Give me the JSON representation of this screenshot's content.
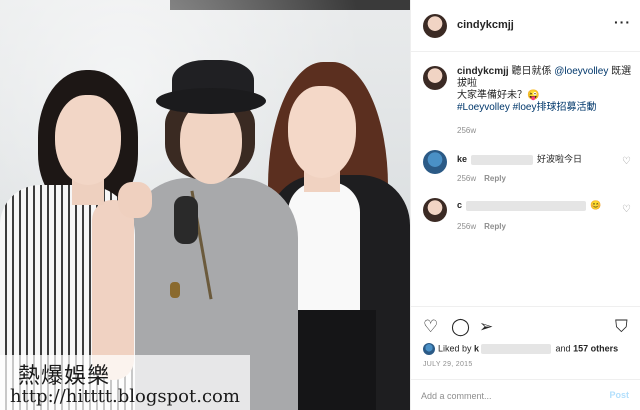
{
  "post": {
    "username": "cindykcmjj",
    "more_label": "···",
    "caption_user": "cindykcmjj",
    "caption_text_1": " 聽日就係 ",
    "caption_mention": "@loeyvolley",
    "caption_text_2": " 既選拔啦",
    "caption_line2": "大家準備好未？😜",
    "caption_tags": "#Loeyvolley #loey排球招募活動",
    "caption_age": "256w"
  },
  "comments": [
    {
      "user_prefix": "ke",
      "text": "好波啦今日",
      "age": "256w",
      "reply": "Reply"
    },
    {
      "user_prefix": "c",
      "text": "😊",
      "age": "256w",
      "reply": "Reply"
    }
  ],
  "actions": {
    "like_icon": "♡",
    "comment_icon": "◯",
    "share_icon": "➢",
    "save_icon": "⛉",
    "comment_like_icon": "♡",
    "likes_prefix": "Liked by ",
    "likes_user_prefix": "k",
    "likes_and": " and ",
    "likes_others": "157 others",
    "date": "JULY 29, 2015"
  },
  "add_comment": {
    "placeholder": "Add a comment...",
    "post_label": "Post"
  },
  "watermark": {
    "line1": "熱爆娛樂",
    "line2": "http://hitttt.blogspot.com"
  },
  "colors": {
    "link": "#00376b",
    "muted": "#8e8e8e",
    "post_disabled": "#b2dffc"
  }
}
